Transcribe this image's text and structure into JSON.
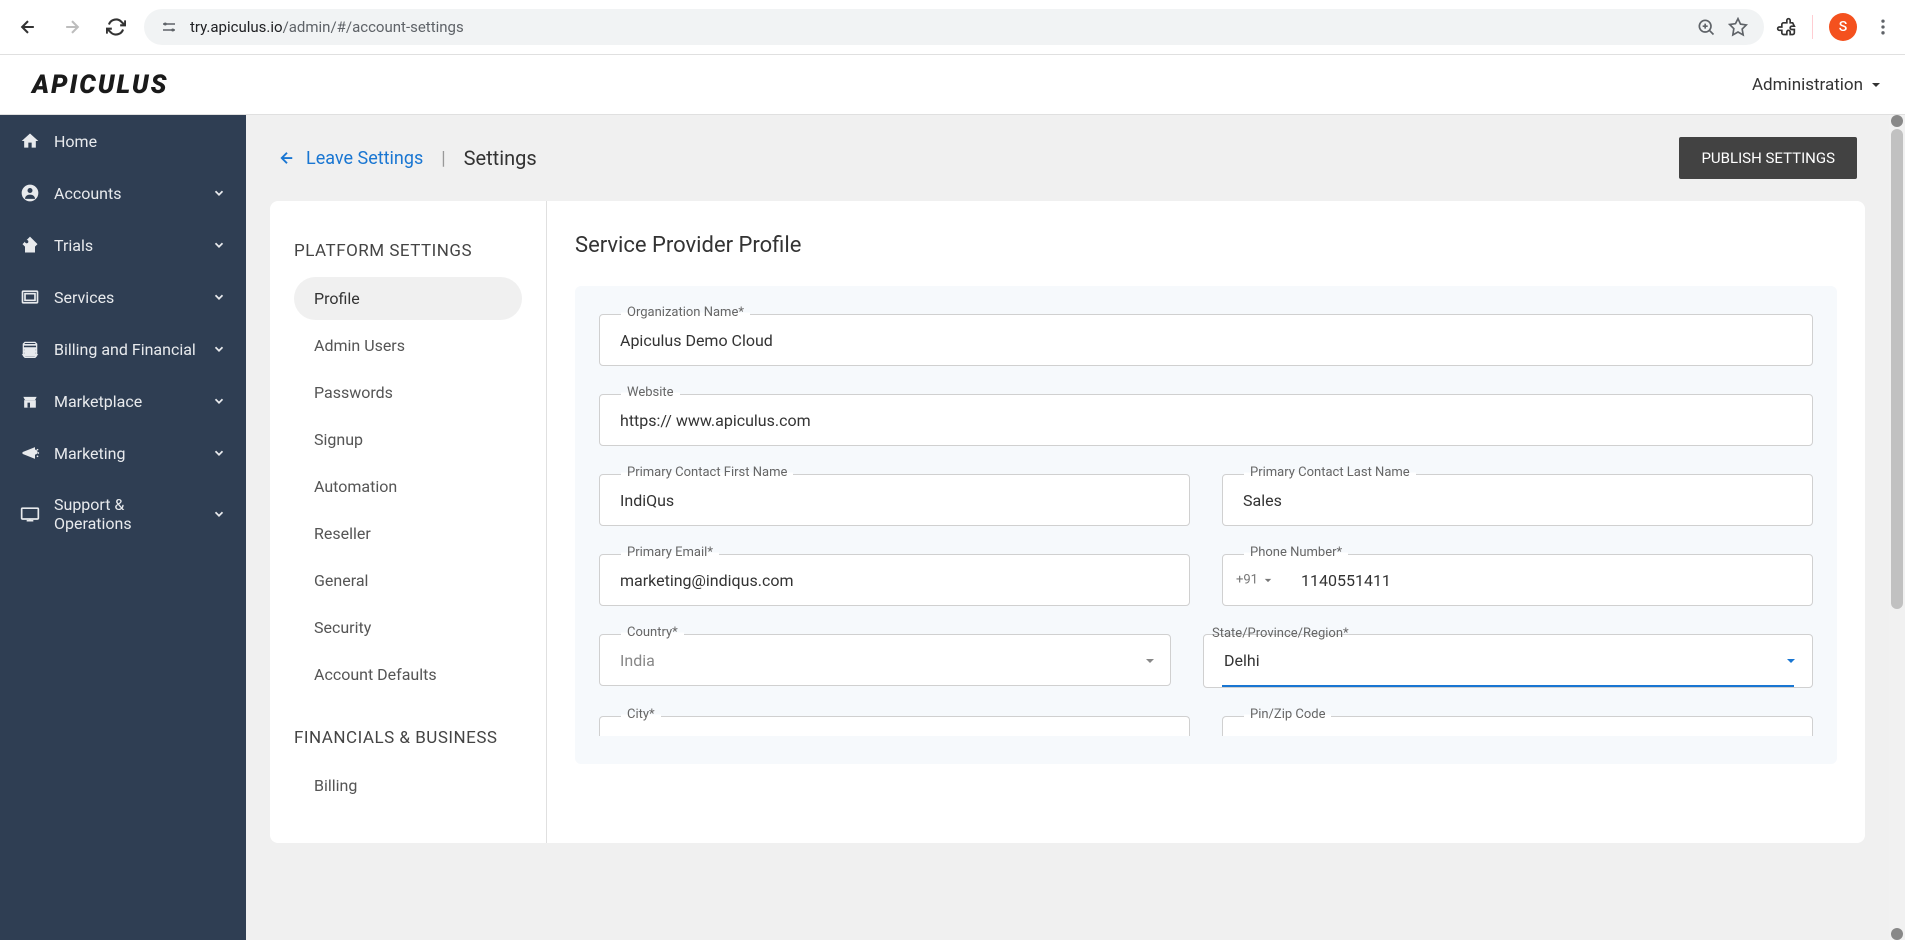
{
  "browser": {
    "url_host": "try.apiculus.io",
    "url_path": "/admin/#/account-settings",
    "avatar_letter": "S"
  },
  "header": {
    "logo_text": "APICULUS",
    "admin_label": "Administration"
  },
  "sidebar": {
    "items": [
      {
        "label": "Home",
        "expandable": false
      },
      {
        "label": "Accounts",
        "expandable": true
      },
      {
        "label": "Trials",
        "expandable": true
      },
      {
        "label": "Services",
        "expandable": true
      },
      {
        "label": "Billing and Financial",
        "expandable": true
      },
      {
        "label": "Marketplace",
        "expandable": true
      },
      {
        "label": "Marketing",
        "expandable": true
      },
      {
        "label": "Support & Operations",
        "expandable": true
      }
    ]
  },
  "content_header": {
    "leave_label": "Leave Settings",
    "page_title": "Settings",
    "publish_label": "PUBLISH SETTINGS"
  },
  "settings_nav": {
    "section1_title": "PLATFORM SETTINGS",
    "section1_items": [
      "Profile",
      "Admin Users",
      "Passwords",
      "Signup",
      "Automation",
      "Reseller",
      "General",
      "Security",
      "Account Defaults"
    ],
    "section2_title": "FINANCIALS & BUSINESS",
    "section2_items": [
      "Billing"
    ]
  },
  "form": {
    "title": "Service Provider Profile",
    "org_label": "Organization Name*",
    "org_value": "Apiculus Demo Cloud",
    "website_label": "Website",
    "website_value": "https:// www.apiculus.com",
    "firstname_label": "Primary Contact First Name",
    "firstname_value": "IndiQus",
    "lastname_label": "Primary Contact Last Name",
    "lastname_value": "Sales",
    "email_label": "Primary Email*",
    "email_value": "marketing@indiqus.com",
    "phone_label": "Phone Number*",
    "phone_prefix": "+91",
    "phone_value": "1140551411",
    "country_label": "Country*",
    "country_value": "India",
    "state_label": "State/Province/Region*",
    "state_value": "Delhi",
    "city_label": "City*",
    "city_value": "",
    "zip_label": "Pin/Zip Code",
    "zip_value": ""
  }
}
